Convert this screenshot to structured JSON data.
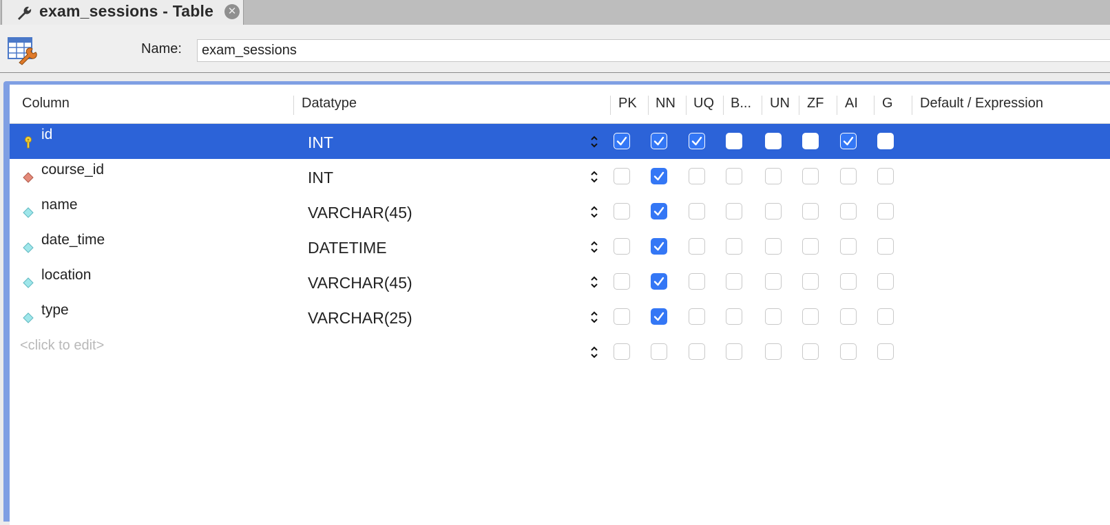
{
  "tab": {
    "title": "exam_sessions - Table"
  },
  "name_field": {
    "label": "Name:",
    "value": "exam_sessions"
  },
  "columns_header": [
    "Column",
    "Datatype",
    "PK",
    "NN",
    "UQ",
    "B...",
    "UN",
    "ZF",
    "AI",
    "G",
    "Default / Expression"
  ],
  "rows": [
    {
      "name": "id",
      "datatype": "INT",
      "icon": "primary-key-icon",
      "selected": true,
      "flags": {
        "PK": true,
        "NN": true,
        "UQ": true,
        "B": false,
        "UN": false,
        "ZF": false,
        "AI": true,
        "G": false
      }
    },
    {
      "name": "course_id",
      "datatype": "INT",
      "icon": "foreign-key-icon",
      "selected": false,
      "flags": {
        "PK": false,
        "NN": true,
        "UQ": false,
        "B": false,
        "UN": false,
        "ZF": false,
        "AI": false,
        "G": false
      }
    },
    {
      "name": "name",
      "datatype": "VARCHAR(45)",
      "icon": "column-icon",
      "selected": false,
      "flags": {
        "PK": false,
        "NN": true,
        "UQ": false,
        "B": false,
        "UN": false,
        "ZF": false,
        "AI": false,
        "G": false
      }
    },
    {
      "name": "date_time",
      "datatype": "DATETIME",
      "icon": "column-icon",
      "selected": false,
      "flags": {
        "PK": false,
        "NN": true,
        "UQ": false,
        "B": false,
        "UN": false,
        "ZF": false,
        "AI": false,
        "G": false
      }
    },
    {
      "name": "location",
      "datatype": "VARCHAR(45)",
      "icon": "column-icon",
      "selected": false,
      "flags": {
        "PK": false,
        "NN": true,
        "UQ": false,
        "B": false,
        "UN": false,
        "ZF": false,
        "AI": false,
        "G": false
      }
    },
    {
      "name": "type",
      "datatype": "VARCHAR(25)",
      "icon": "column-icon",
      "selected": false,
      "flags": {
        "PK": false,
        "NN": true,
        "UQ": false,
        "B": false,
        "UN": false,
        "ZF": false,
        "AI": false,
        "G": false
      }
    }
  ],
  "new_row": {
    "placeholder": "<click to edit>",
    "flags": {
      "PK": false,
      "NN": false,
      "UQ": false,
      "B": false,
      "UN": false,
      "ZF": false,
      "AI": false,
      "G": false
    }
  },
  "colors": {
    "selection": "#2c63d8",
    "checkbox_on": "#3477f5",
    "grid_border": "#7f9fe3"
  }
}
